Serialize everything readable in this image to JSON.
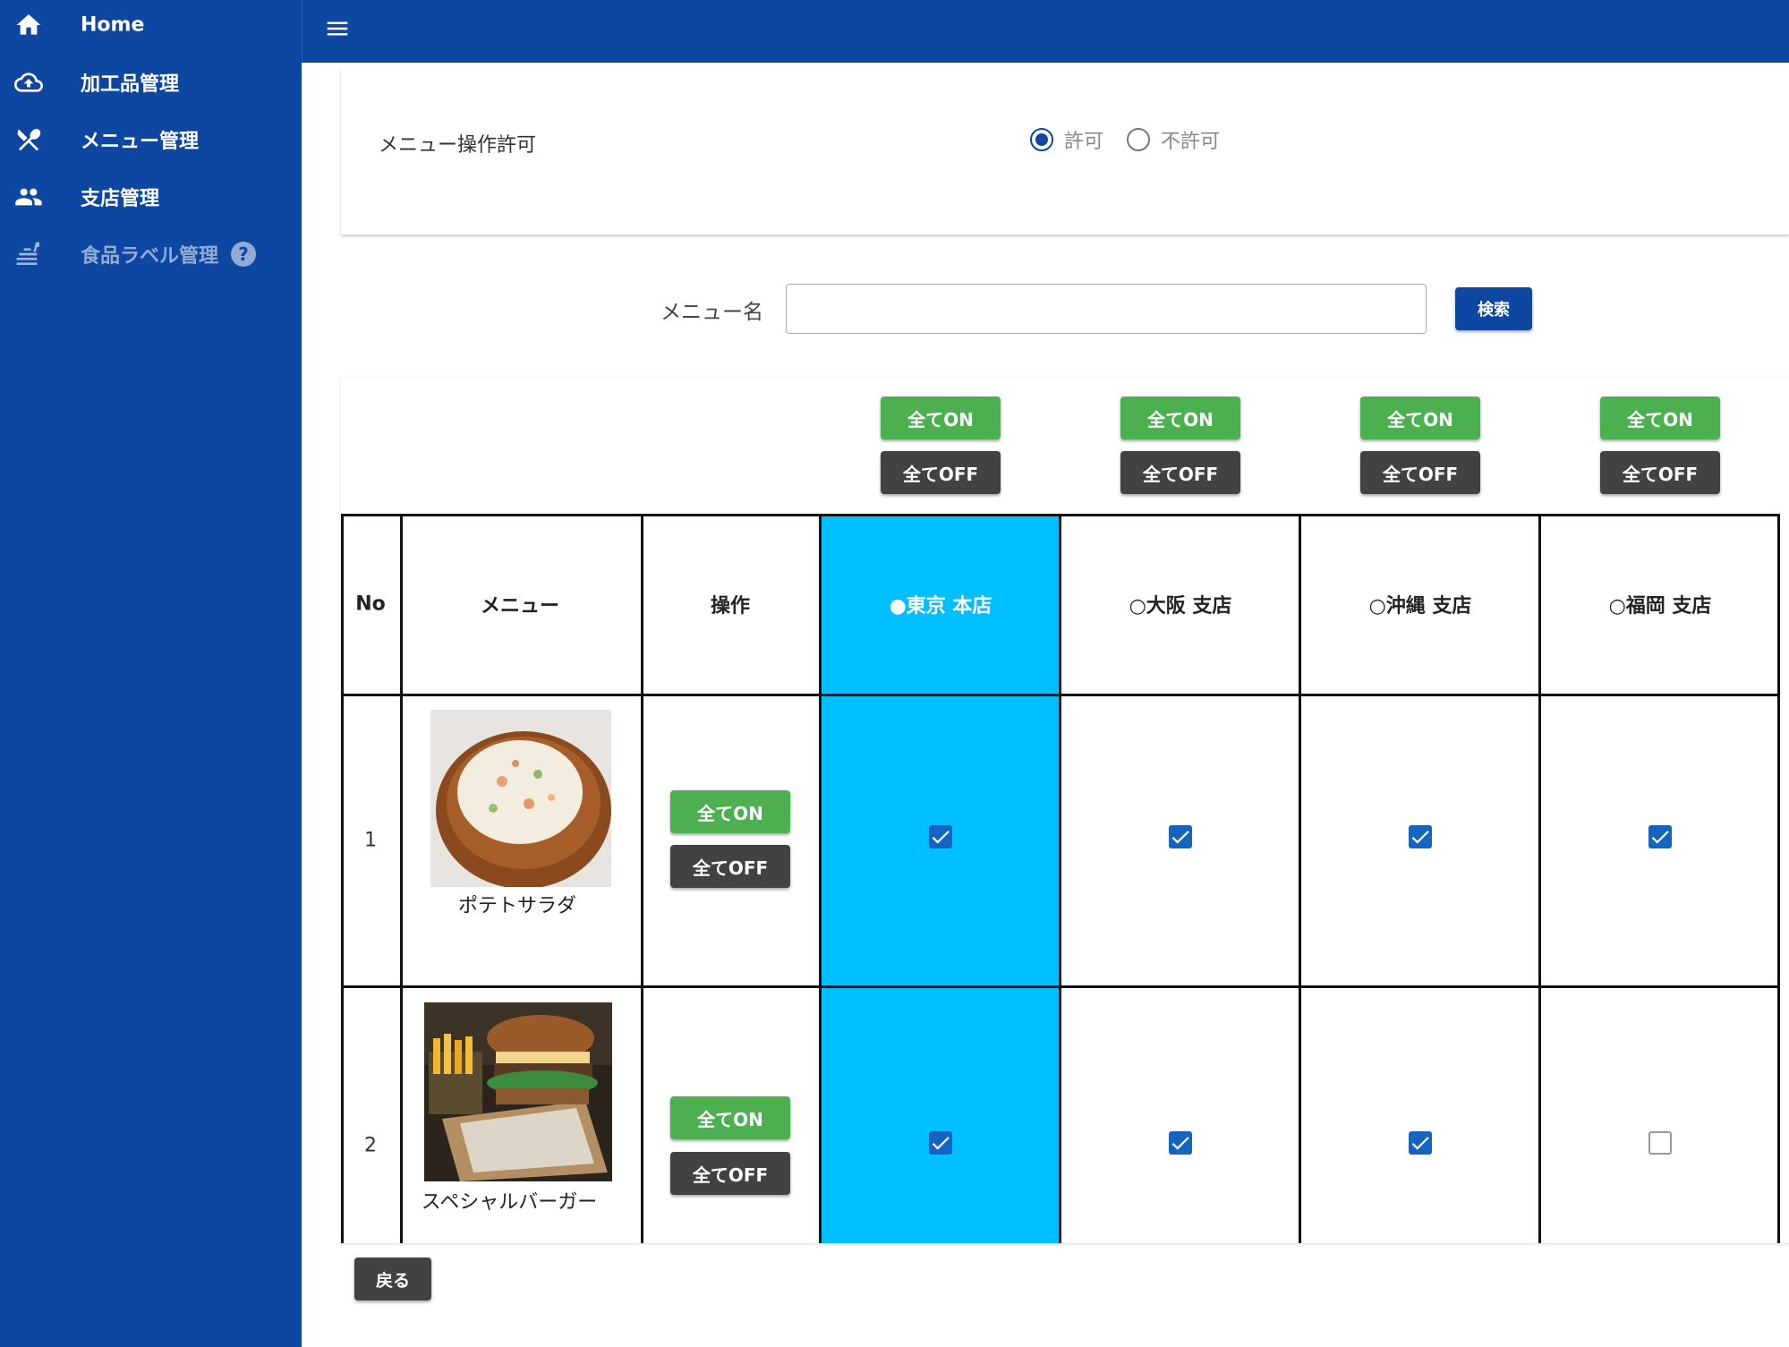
{
  "sidebar": {
    "items": [
      {
        "label": "Home",
        "icon": "home-icon"
      },
      {
        "label": "加工品管理",
        "icon": "cloud-upload-icon"
      },
      {
        "label": "メニュー管理",
        "icon": "utensils-icon"
      },
      {
        "label": "支店管理",
        "icon": "people-icon"
      },
      {
        "label": "食品ラベル管理",
        "icon": "food-label-icon",
        "help": "?"
      }
    ]
  },
  "permission": {
    "label": "メニュー操作許可",
    "options": [
      "許可",
      "不許可"
    ],
    "selected": "許可"
  },
  "search": {
    "label": "メニュー名",
    "value": "",
    "button": "検索"
  },
  "table": {
    "all_on_label": "全てON",
    "all_off_label": "全てOFF",
    "headers": {
      "no": "No",
      "menu": "メニュー",
      "operation": "操作"
    },
    "stores": [
      {
        "label": "●東京 本店",
        "selected": true
      },
      {
        "label": "○大阪 支店",
        "selected": false
      },
      {
        "label": "○沖縄 支店",
        "selected": false
      },
      {
        "label": "○福岡 支店",
        "selected": false
      }
    ],
    "rows": [
      {
        "no": "1",
        "menu": "ポテトサラダ",
        "image": "potato-salad-photo",
        "checks": [
          true,
          true,
          true,
          true
        ]
      },
      {
        "no": "2",
        "menu": "スペシャルバーガー",
        "image": "burger-photo",
        "checks": [
          true,
          true,
          true,
          false
        ]
      }
    ]
  },
  "back_button": "戻る",
  "colors": {
    "primary": "#0d47a1",
    "on_button": "#4caf50",
    "off_button": "#424242",
    "selected_store": "#00bfff",
    "checkbox": "#1565c0"
  }
}
